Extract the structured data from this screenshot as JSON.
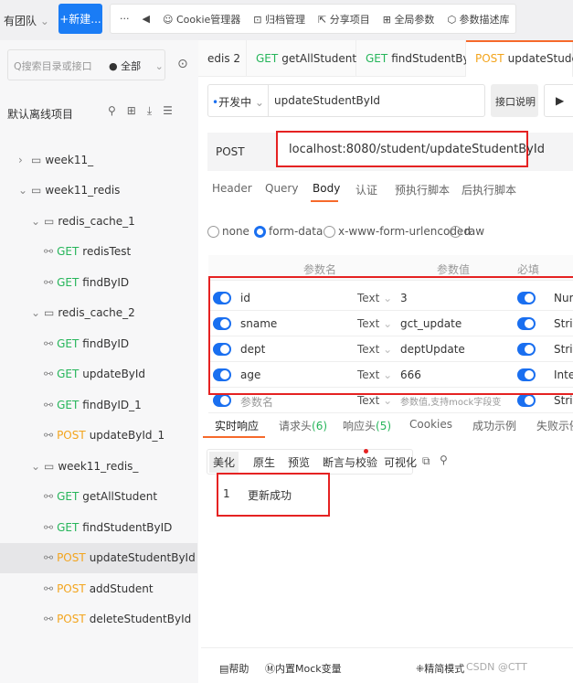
{
  "topbar": {
    "team": "有团队",
    "new_button": "+新建...",
    "more": "···",
    "items": [
      "Cookie管理器",
      "归档管理",
      "分享项目",
      "全局参数",
      "参数描述库"
    ]
  },
  "sidebar": {
    "search_placeholder": "搜索目录或接口",
    "filter": "全部",
    "project": "默认离线项目",
    "items": [
      {
        "type": "folder",
        "label": "week11_",
        "indent": 0,
        "collapsed": true
      },
      {
        "type": "folder",
        "label": "week11_redis",
        "indent": 0
      },
      {
        "type": "folder",
        "label": "redis_cache_1",
        "indent": 1
      },
      {
        "type": "api",
        "method": "GET",
        "label": "redisTest",
        "indent": 2
      },
      {
        "type": "api",
        "method": "GET",
        "label": "findByID",
        "indent": 2
      },
      {
        "type": "folder",
        "label": "redis_cache_2",
        "indent": 1
      },
      {
        "type": "api",
        "method": "GET",
        "label": "findByID",
        "indent": 2
      },
      {
        "type": "api",
        "method": "GET",
        "label": "updateById",
        "indent": 2
      },
      {
        "type": "api",
        "method": "GET",
        "label": "findByID_1",
        "indent": 2
      },
      {
        "type": "api",
        "method": "POST",
        "label": "updateById_1",
        "indent": 2
      },
      {
        "type": "folder",
        "label": "week11_redis_",
        "indent": 1
      },
      {
        "type": "api",
        "method": "GET",
        "label": "getAllStudent",
        "indent": 2
      },
      {
        "type": "api",
        "method": "GET",
        "label": "findStudentByID",
        "indent": 2
      },
      {
        "type": "api",
        "method": "POST",
        "label": "updateStudentById",
        "indent": 2,
        "selected": true
      },
      {
        "type": "api",
        "method": "POST",
        "label": "addStudent",
        "indent": 2
      },
      {
        "type": "api",
        "method": "POST",
        "label": "deleteStudentById",
        "indent": 2
      }
    ]
  },
  "tabs": [
    {
      "method": "",
      "label": "edis 2"
    },
    {
      "method": "GET",
      "label": "getAllStudent"
    },
    {
      "method": "GET",
      "label": "findStudentByII"
    },
    {
      "method": "POST",
      "label": "updateStuder",
      "active": true
    }
  ],
  "request": {
    "status": "开发中",
    "name": "updateStudentById",
    "doc_button": "接口说明",
    "method": "POST",
    "url": "localhost:8080/student/updateStudentById",
    "subtabs": [
      "Header",
      "Query",
      "Body",
      "认证",
      "预执行脚本",
      "后执行脚本"
    ],
    "active_subtab": "Body",
    "body_types": [
      "none",
      "form-data",
      "x-www-form-urlencoded",
      "raw"
    ],
    "body_type": "form-data",
    "columns": [
      "参数名",
      "参数值",
      "必填"
    ],
    "params": [
      {
        "name": "id",
        "type": "Text",
        "value": "3",
        "dtype": "Num"
      },
      {
        "name": "sname",
        "type": "Text",
        "value": "gct_update",
        "dtype": "Stri"
      },
      {
        "name": "dept",
        "type": "Text",
        "value": "deptUpdate",
        "dtype": "Stri"
      },
      {
        "name": "age",
        "type": "Text",
        "value": "666",
        "dtype": "Inte"
      }
    ],
    "new_row": {
      "name_placeholder": "参数名",
      "type": "Text",
      "value_placeholder": "参数值,支持mock字段变",
      "dtype": "Stri"
    }
  },
  "response": {
    "tabs": [
      "实时响应",
      "请求头",
      "响应头",
      "Cookies",
      "成功示例",
      "失败示例"
    ],
    "req_headers_count": "(6)",
    "resp_headers_count": "(5)",
    "view_tabs": [
      "美化",
      "原生",
      "预览",
      "断言与校验",
      "可视化"
    ],
    "line_no": "1",
    "body": "更新成功"
  },
  "footer": {
    "help": "帮助",
    "mock": "内置Mock变量",
    "simple": "精简模式",
    "watermark": "CSDN @CTT"
  },
  "colors": {
    "accent": "#1a7cf5",
    "get": "#26b55a",
    "post": "#f3a41c",
    "highlight": "#e52222"
  }
}
